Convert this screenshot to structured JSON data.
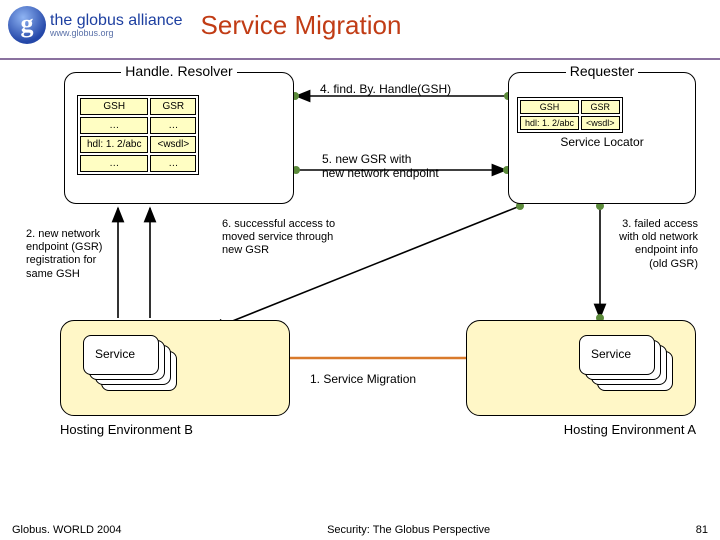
{
  "brand": {
    "top": "the globus alliance",
    "sub": "www.globus.org"
  },
  "title": "Service Migration",
  "handleResolver": {
    "label": "Handle. Resolver",
    "cols": [
      "GSH",
      "GSR"
    ],
    "rows": [
      [
        "…",
        "…"
      ],
      [
        "hdl: 1. 2/abc",
        "<wsdl>"
      ],
      [
        "…",
        "…"
      ]
    ]
  },
  "requester": {
    "label": "Requester",
    "serviceLocator": "Service Locator",
    "cols": [
      "GSH",
      "GSR"
    ],
    "row": [
      "hdl: 1. 2/abc",
      "<wsdl>"
    ]
  },
  "steps": {
    "s1": "1. Service Migration",
    "s2": "2. new network\nendpoint (GSR)\nregistration for\nsame GSH",
    "s3": "3. failed access\nwith old network\nendpoint info\n(old GSR)",
    "s4": "4. find. By. Handle(GSH)",
    "s5": "5. new GSR with\nnew network endpoint",
    "s6": "6. successful access to\nmoved service through\nnew GSR"
  },
  "service": "Service",
  "envA": "Hosting Environment A",
  "envB": "Hosting Environment B",
  "footer": {
    "left": "Globus. WORLD 2004",
    "center": "Security: The Globus Perspective",
    "right": "81"
  }
}
